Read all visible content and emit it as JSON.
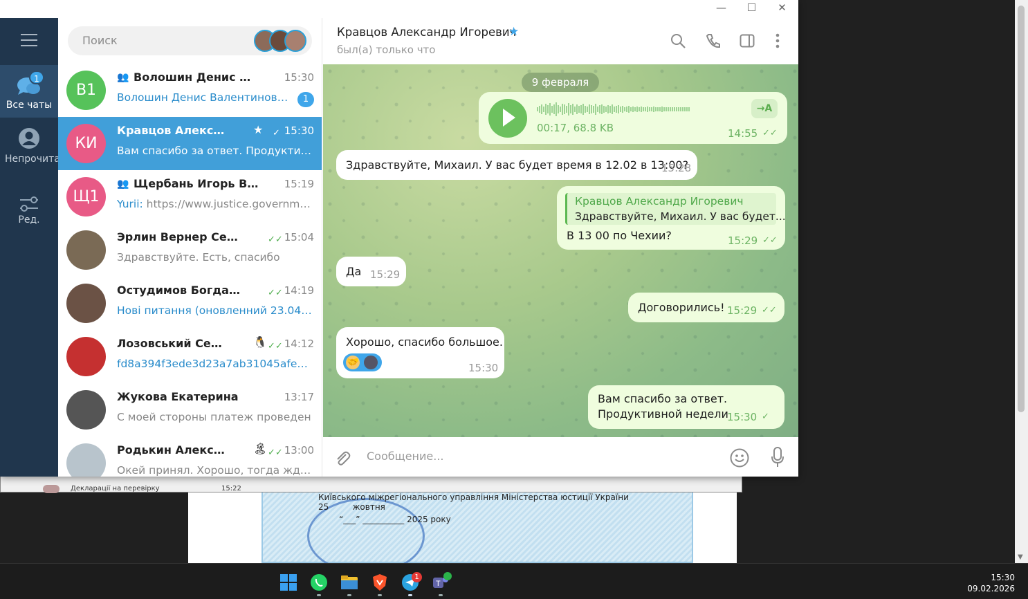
{
  "background": {
    "list_row_title": "Декларації на перевірку",
    "list_row_time": "15:22",
    "certificate_line1": "Київського міжрегіонального управління Міністерства юстиції України",
    "certificate_line2": "“___” __________ 2025 року",
    "certificate_month": "жовтня",
    "certificate_day": "25"
  },
  "window": {
    "minimize_label": "—",
    "maximize_label": "☐",
    "close_label": "✕"
  },
  "nav": {
    "menu_icon": "hamburger-icon",
    "items": [
      {
        "label": "Все чаты",
        "icon": "chats-icon",
        "badge": "1",
        "active": true
      },
      {
        "label": "Непрочитано",
        "icon": "person-icon"
      },
      {
        "label": "Ред.",
        "icon": "edit-filters-icon"
      }
    ]
  },
  "search": {
    "placeholder": "Поиск"
  },
  "chats": [
    {
      "avatar": "В1",
      "avatar_color": "#56c25a",
      "name": "Волошин Денис Валент...",
      "group": true,
      "time": "15:30",
      "preview": "Волошин Денис Валентинович...",
      "preview_blue": true,
      "badge": "1"
    },
    {
      "avatar": "КИ",
      "avatar_color": "#e85a86",
      "name": "Кравцов Александр И...",
      "star": "★",
      "ticks": "✓",
      "time": "15:30",
      "preview": "Вам спасибо за ответ.  Продуктивн...",
      "active": true
    },
    {
      "avatar": "Щ1",
      "avatar_color": "#e85a86",
      "name": "Щербань Игорь Василье...",
      "group": true,
      "time": "15:19",
      "preview_sender": "Yurii: ",
      "preview": "https://www.justice.governme..."
    },
    {
      "avatar": "",
      "avatar_color": "#7a6a55",
      "name": "Эрлин Вернер Сергеевич",
      "ticks": "✓✓",
      "time": "15:04",
      "preview": "Здравствуйте. Есть, спасибо"
    },
    {
      "avatar": "",
      "avatar_color": "#6b5245",
      "name": "Остудимов Богдан Анат...",
      "ticks": "✓✓",
      "time": "14:19",
      "preview": "Нові питання (оновленний 23.04.2...",
      "preview_blue": true
    },
    {
      "avatar": "",
      "avatar_color": "#c53030",
      "name": "Лозовський Сергей Д...",
      "emoji": "🐧",
      "ticks": "✓✓",
      "time": "14:12",
      "preview": "fd8a394f3ede3d23a7ab31045afe50f...",
      "preview_blue": true
    },
    {
      "avatar": "",
      "avatar_color": "#555555",
      "name": "Жукова Екатерина",
      "time": "13:17",
      "preview": "С моей стороны платеж проведен"
    },
    {
      "avatar": "",
      "avatar_color": "#b8c4cc",
      "name": "Родькин Александр В...",
      "emoji": "🏝",
      "ticks": "✓✓",
      "time": "13:00",
      "preview": "Окей принял. Хорошо, тогда ждем..."
    }
  ],
  "header": {
    "name": "Кравцов Александр Игоревич",
    "star": "★",
    "status": "был(а) только что"
  },
  "messages": {
    "date": "9 февраля",
    "voice": {
      "meta": "00:17, 68.8 KB",
      "time": "14:55",
      "transcribe": "→A"
    },
    "m1": {
      "text": "Здравствуйте, Михаил. У вас будет время в 12.02 в 13:00?",
      "time": "15:28"
    },
    "m2": {
      "reply_name": "Кравцов Александр Игоревич",
      "reply_text": "Здравствуйте, Михаил. У вас будет...",
      "text": "В 13 00 по Чехии?",
      "time": "15:29"
    },
    "m3": {
      "text": "Да",
      "time": "15:29"
    },
    "m4": {
      "text": "Договорились!",
      "time": "15:29"
    },
    "m5": {
      "text": "Хорошо, спасибо большое.",
      "time": "15:30",
      "reaction": "🤝"
    },
    "m6": {
      "line1": "Вам спасибо за ответ.",
      "line2": "Продуктивной недели",
      "time": "15:30"
    }
  },
  "composer": {
    "placeholder": "Сообщение..."
  },
  "taskbar": {
    "apps": [
      "windows-start-icon",
      "whatsapp-icon",
      "file-explorer-icon",
      "brave-icon",
      "telegram-icon",
      "teams-icon"
    ],
    "telegram_badge": "1",
    "time": "15:30",
    "date": "09.02.2026"
  }
}
